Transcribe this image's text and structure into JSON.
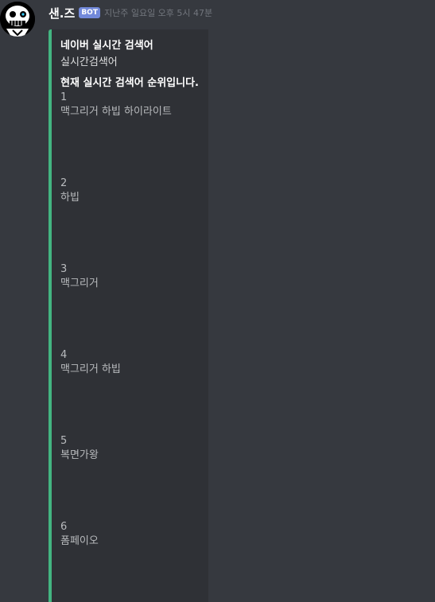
{
  "message": {
    "username": "샌.즈",
    "bot_tag": "BOT",
    "timestamp": "지난주 일요일 오후 5시 47분"
  },
  "embed": {
    "accent_color": "#43b581",
    "author": "네이버 실시간 검색어",
    "title": "실시간검색어",
    "description": "현재 실시간 검색어 순위입니다.",
    "fields": [
      {
        "name": "1",
        "value": "맥그리거 하빕 하이라이트"
      },
      {
        "name": "2",
        "value": "하빕"
      },
      {
        "name": "3",
        "value": "맥그리거"
      },
      {
        "name": "4",
        "value": "맥그리거 하빕"
      },
      {
        "name": "5",
        "value": "복면가왕"
      },
      {
        "name": "6",
        "value": "폼페이오"
      }
    ]
  }
}
